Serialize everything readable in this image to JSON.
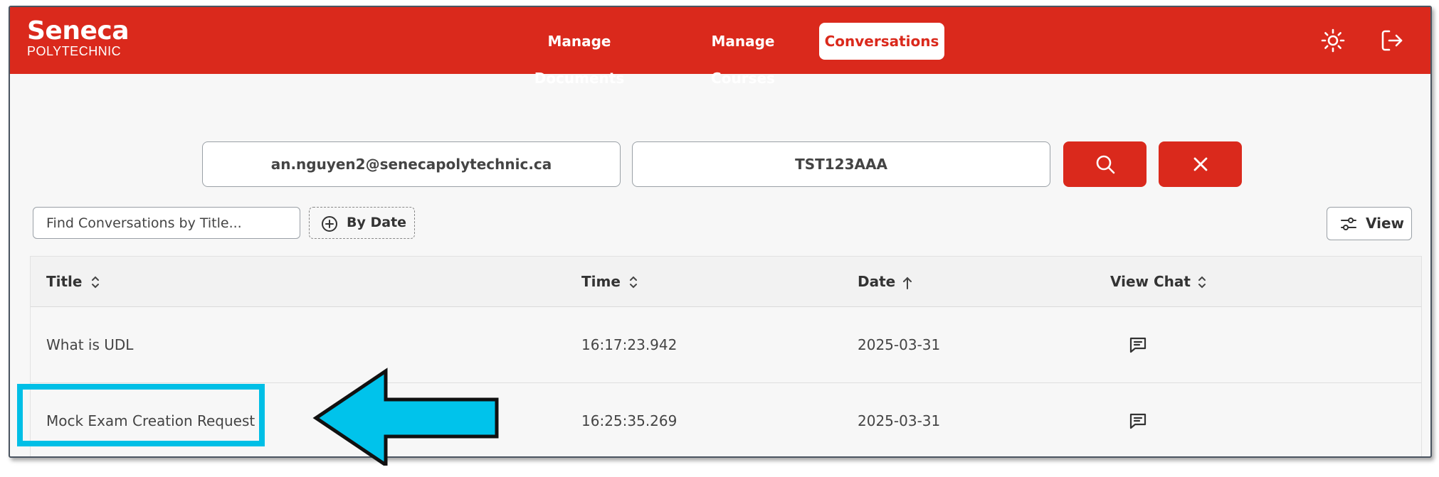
{
  "header": {
    "logo_main": "Seneca",
    "logo_sub": "POLYTECHNIC",
    "nav": [
      {
        "label": "Manage Documents",
        "active": false
      },
      {
        "label": "Manage Courses",
        "active": false
      },
      {
        "label": "Conversations",
        "active": true
      }
    ],
    "icons": [
      "sun-icon",
      "logout-icon"
    ]
  },
  "filters": {
    "email_value": "an.nguyen2@senecapolytechnic.ca",
    "course_value": "TST123AAA",
    "search_icon": "search-icon",
    "clear_icon": "close-icon"
  },
  "toolbar": {
    "find_placeholder": "Find Conversations by Title...",
    "by_date_label": "By Date",
    "view_label": "View"
  },
  "table": {
    "columns": [
      {
        "label": "Title",
        "sort": "none"
      },
      {
        "label": "Time",
        "sort": "none"
      },
      {
        "label": "Date",
        "sort": "ascending"
      },
      {
        "label": "View Chat",
        "sort": "none"
      }
    ],
    "rows": [
      {
        "title": "What is UDL",
        "time": "16:17:23.942",
        "date": "2025-03-31",
        "chat_icon": "chat-icon"
      },
      {
        "title": "Mock Exam Creation Request",
        "time": "16:25:35.269",
        "date": "2025-03-31",
        "chat_icon": "chat-icon"
      }
    ]
  },
  "annotation": {
    "highlight_color": "#00bfe6",
    "arrow_color": "#00c3eb",
    "highlighted_row": 1
  },
  "colors": {
    "brand_red": "#da291c",
    "background": "#f7f7f7"
  }
}
